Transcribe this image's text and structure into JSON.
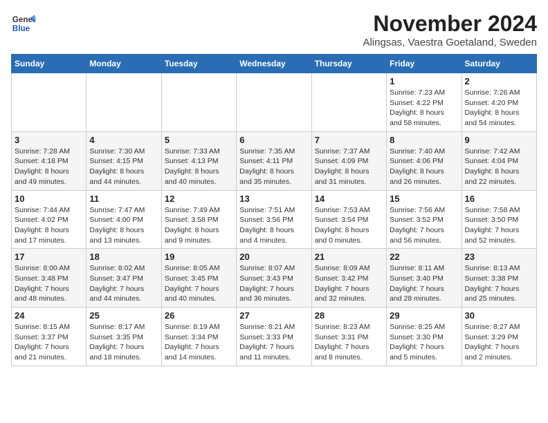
{
  "header": {
    "logo_line1": "General",
    "logo_line2": "Blue",
    "month": "November 2024",
    "location": "Alingsas, Vaestra Goetaland, Sweden"
  },
  "weekdays": [
    "Sunday",
    "Monday",
    "Tuesday",
    "Wednesday",
    "Thursday",
    "Friday",
    "Saturday"
  ],
  "weeks": [
    [
      {
        "day": "",
        "detail": ""
      },
      {
        "day": "",
        "detail": ""
      },
      {
        "day": "",
        "detail": ""
      },
      {
        "day": "",
        "detail": ""
      },
      {
        "day": "",
        "detail": ""
      },
      {
        "day": "1",
        "detail": "Sunrise: 7:23 AM\nSunset: 4:22 PM\nDaylight: 8 hours\nand 58 minutes."
      },
      {
        "day": "2",
        "detail": "Sunrise: 7:26 AM\nSunset: 4:20 PM\nDaylight: 8 hours\nand 54 minutes."
      }
    ],
    [
      {
        "day": "3",
        "detail": "Sunrise: 7:28 AM\nSunset: 4:18 PM\nDaylight: 8 hours\nand 49 minutes."
      },
      {
        "day": "4",
        "detail": "Sunrise: 7:30 AM\nSunset: 4:15 PM\nDaylight: 8 hours\nand 44 minutes."
      },
      {
        "day": "5",
        "detail": "Sunrise: 7:33 AM\nSunset: 4:13 PM\nDaylight: 8 hours\nand 40 minutes."
      },
      {
        "day": "6",
        "detail": "Sunrise: 7:35 AM\nSunset: 4:11 PM\nDaylight: 8 hours\nand 35 minutes."
      },
      {
        "day": "7",
        "detail": "Sunrise: 7:37 AM\nSunset: 4:09 PM\nDaylight: 8 hours\nand 31 minutes."
      },
      {
        "day": "8",
        "detail": "Sunrise: 7:40 AM\nSunset: 4:06 PM\nDaylight: 8 hours\nand 26 minutes."
      },
      {
        "day": "9",
        "detail": "Sunrise: 7:42 AM\nSunset: 4:04 PM\nDaylight: 8 hours\nand 22 minutes."
      }
    ],
    [
      {
        "day": "10",
        "detail": "Sunrise: 7:44 AM\nSunset: 4:02 PM\nDaylight: 8 hours\nand 17 minutes."
      },
      {
        "day": "11",
        "detail": "Sunrise: 7:47 AM\nSunset: 4:00 PM\nDaylight: 8 hours\nand 13 minutes."
      },
      {
        "day": "12",
        "detail": "Sunrise: 7:49 AM\nSunset: 3:58 PM\nDaylight: 8 hours\nand 9 minutes."
      },
      {
        "day": "13",
        "detail": "Sunrise: 7:51 AM\nSunset: 3:56 PM\nDaylight: 8 hours\nand 4 minutes."
      },
      {
        "day": "14",
        "detail": "Sunrise: 7:53 AM\nSunset: 3:54 PM\nDaylight: 8 hours\nand 0 minutes."
      },
      {
        "day": "15",
        "detail": "Sunrise: 7:56 AM\nSunset: 3:52 PM\nDaylight: 7 hours\nand 56 minutes."
      },
      {
        "day": "16",
        "detail": "Sunrise: 7:58 AM\nSunset: 3:50 PM\nDaylight: 7 hours\nand 52 minutes."
      }
    ],
    [
      {
        "day": "17",
        "detail": "Sunrise: 8:00 AM\nSunset: 3:48 PM\nDaylight: 7 hours\nand 48 minutes."
      },
      {
        "day": "18",
        "detail": "Sunrise: 8:02 AM\nSunset: 3:47 PM\nDaylight: 7 hours\nand 44 minutes."
      },
      {
        "day": "19",
        "detail": "Sunrise: 8:05 AM\nSunset: 3:45 PM\nDaylight: 7 hours\nand 40 minutes."
      },
      {
        "day": "20",
        "detail": "Sunrise: 8:07 AM\nSunset: 3:43 PM\nDaylight: 7 hours\nand 36 minutes."
      },
      {
        "day": "21",
        "detail": "Sunrise: 8:09 AM\nSunset: 3:42 PM\nDaylight: 7 hours\nand 32 minutes."
      },
      {
        "day": "22",
        "detail": "Sunrise: 8:11 AM\nSunset: 3:40 PM\nDaylight: 7 hours\nand 28 minutes."
      },
      {
        "day": "23",
        "detail": "Sunrise: 8:13 AM\nSunset: 3:38 PM\nDaylight: 7 hours\nand 25 minutes."
      }
    ],
    [
      {
        "day": "24",
        "detail": "Sunrise: 8:15 AM\nSunset: 3:37 PM\nDaylight: 7 hours\nand 21 minutes."
      },
      {
        "day": "25",
        "detail": "Sunrise: 8:17 AM\nSunset: 3:35 PM\nDaylight: 7 hours\nand 18 minutes."
      },
      {
        "day": "26",
        "detail": "Sunrise: 8:19 AM\nSunset: 3:34 PM\nDaylight: 7 hours\nand 14 minutes."
      },
      {
        "day": "27",
        "detail": "Sunrise: 8:21 AM\nSunset: 3:33 PM\nDaylight: 7 hours\nand 11 minutes."
      },
      {
        "day": "28",
        "detail": "Sunrise: 8:23 AM\nSunset: 3:31 PM\nDaylight: 7 hours\nand 8 minutes."
      },
      {
        "day": "29",
        "detail": "Sunrise: 8:25 AM\nSunset: 3:30 PM\nDaylight: 7 hours\nand 5 minutes."
      },
      {
        "day": "30",
        "detail": "Sunrise: 8:27 AM\nSunset: 3:29 PM\nDaylight: 7 hours\nand 2 minutes."
      }
    ]
  ]
}
